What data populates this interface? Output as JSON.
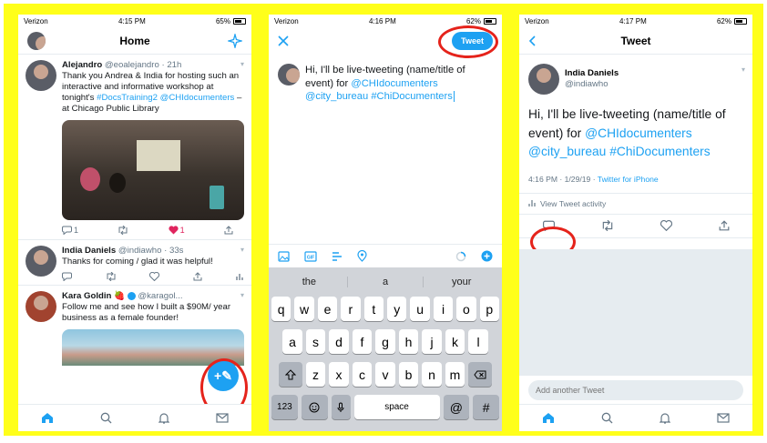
{
  "phone1": {
    "status": {
      "carrier": "Verizon",
      "time": "4:15 PM",
      "battery": "65%"
    },
    "header_title": "Home",
    "tweets": [
      {
        "name": "Alejandro",
        "handle": "@eoalejandro · 21h",
        "text_a": "Thank you Andrea & India for hosting such an interactive and informative workshop at tonight's ",
        "tag1": "#DocsTraining2",
        "mention": "@CHIdocumenters",
        "text_b": " – at Chicago Public Library",
        "replies": "1",
        "likes": "1"
      },
      {
        "name": "India Daniels",
        "handle": "@indiawho · 33s",
        "text": "Thanks for coming / glad it was helpful!"
      },
      {
        "name": "Kara Goldin",
        "emoji": "🍓",
        "handle": "@karagol...",
        "text": "Follow me and see how I built a $90M/ year business as a female founder!"
      }
    ]
  },
  "phone2": {
    "status": {
      "carrier": "Verizon",
      "time": "4:16 PM",
      "battery": "62%"
    },
    "tweet_button": "Tweet",
    "compose": {
      "text_a": "Hi, I'll be live-tweeting (name/title of event) for ",
      "m1": "@CHIdocumenters",
      "m2": "@city_bureau",
      "tag": "#ChiDocumenters"
    },
    "suggestions": [
      "the",
      "a",
      "your"
    ],
    "keys_row1": [
      "q",
      "w",
      "e",
      "r",
      "t",
      "y",
      "u",
      "i",
      "o",
      "p"
    ],
    "keys_row2": [
      "a",
      "s",
      "d",
      "f",
      "g",
      "h",
      "j",
      "k",
      "l"
    ],
    "keys_row3": [
      "z",
      "x",
      "c",
      "v",
      "b",
      "n",
      "m"
    ],
    "key_123": "123",
    "key_space": "space",
    "key_at": "@",
    "key_hash": "#"
  },
  "phone3": {
    "status": {
      "carrier": "Verizon",
      "time": "4:17 PM",
      "battery": "62%"
    },
    "header_title": "Tweet",
    "author": {
      "name": "India Daniels",
      "handle": "@indiawho"
    },
    "text_a": "Hi, I'll be live-tweeting (name/title of event) for ",
    "m1": "@CHIdocumenters",
    "m2": "@city_bureau",
    "tag": "#ChiDocumenters",
    "meta_time": "4:16 PM · 1/29/19 · ",
    "meta_source": "Twitter for iPhone",
    "activity": "View Tweet activity",
    "reply_placeholder": "Add another Tweet"
  },
  "colors": {
    "accent": "#1da1f2",
    "highlight": "#e5231b",
    "frame": "#ffff1a",
    "like": "#e0245e"
  }
}
